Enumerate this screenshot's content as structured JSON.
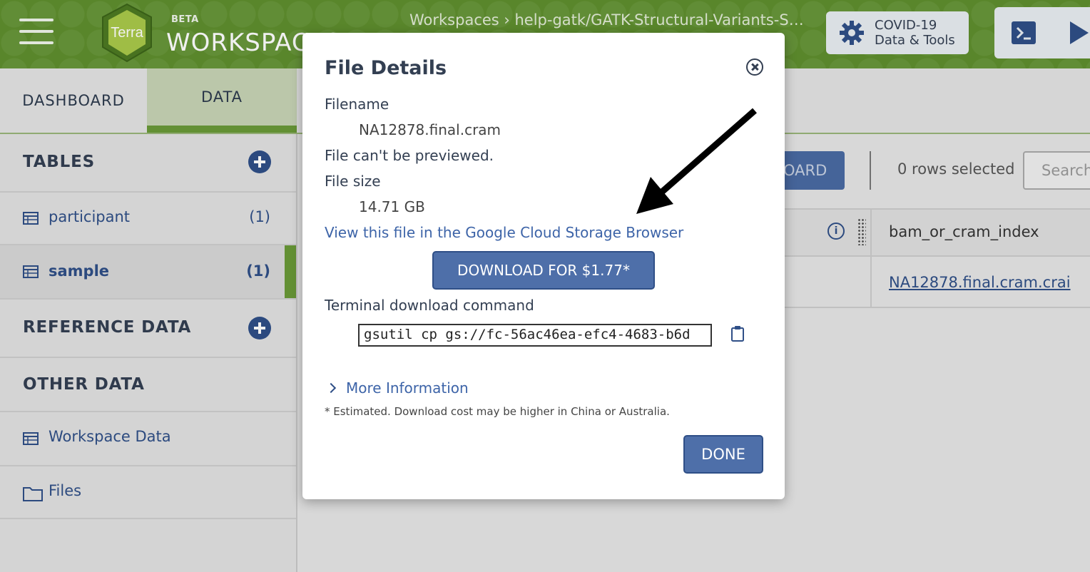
{
  "header": {
    "logo_text": "Terra",
    "beta_label": "BETA",
    "app_title": "WORKSPACES",
    "breadcrumb": "Workspaces  ›  help-gatk/GATK-Structural-Variants-S…",
    "covid_line1": "COVID-19",
    "covid_line2": "Data & Tools",
    "brand_color": "#5f8f2e"
  },
  "tabs": {
    "dashboard": "DASHBOARD",
    "data": "DATA"
  },
  "sidebar": {
    "tables_title": "TABLES",
    "tables": [
      {
        "label": "participant",
        "count": "(1)"
      },
      {
        "label": "sample",
        "count": "(1)"
      }
    ],
    "reference_title": "REFERENCE DATA",
    "other_title": "OTHER DATA",
    "other_items": [
      {
        "label": "Workspace Data",
        "icon": "table-icon"
      },
      {
        "label": "Files",
        "icon": "folder-icon"
      }
    ]
  },
  "main": {
    "download_btn_partial": "OARD",
    "rows_selected": "0 rows selected",
    "search_placeholder": "Search",
    "column_header": "bam_or_cram_index",
    "cell_value": "NA12878.final.cram.crai"
  },
  "modal": {
    "title": "File Details",
    "filename_label": "Filename",
    "filename_value": "NA12878.final.cram",
    "preview_note": "File can't be previewed.",
    "filesize_label": "File size",
    "filesize_value": "14.71 GB",
    "gcs_link": "View this file in the Google Cloud Storage Browser",
    "download_button": "DOWNLOAD FOR $1.77*",
    "terminal_label": "Terminal download command",
    "terminal_command": "gsutil cp gs://fc-56ac46ea-efc4-4683-b6d",
    "more_info": "More Information",
    "footnote": "* Estimated. Download cost may be higher in China or Australia.",
    "done_button": "DONE",
    "accent_color": "#4e6fa9"
  }
}
